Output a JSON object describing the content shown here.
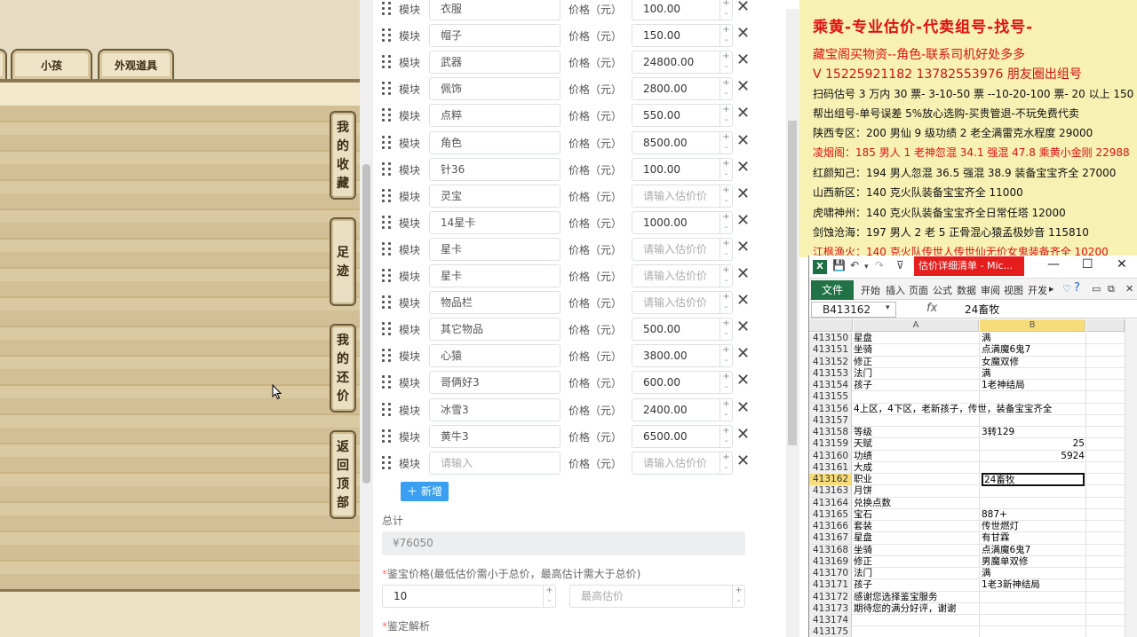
{
  "game": {
    "tabs": [
      "小孩",
      "外观道具"
    ],
    "side_buttons": [
      {
        "id": "collection",
        "chars": [
          "我",
          "的",
          "收",
          "藏"
        ]
      },
      {
        "id": "footprint",
        "chars": [
          "足",
          "迹"
        ]
      },
      {
        "id": "bargain",
        "chars": [
          "我",
          "的",
          "还",
          "价"
        ]
      },
      {
        "id": "top",
        "chars": [
          "返",
          "回",
          "顶",
          "部"
        ]
      }
    ]
  },
  "form": {
    "module_label": "模块",
    "price_label": "价格（元）",
    "name_placeholder": "请输入",
    "price_placeholder": "请输入估价价",
    "rows": [
      {
        "name": "衣服",
        "price": "100.00"
      },
      {
        "name": "帽子",
        "price": "150.00"
      },
      {
        "name": "武器",
        "price": "24800.00"
      },
      {
        "name": "佩饰",
        "price": "2800.00"
      },
      {
        "name": "点粹",
        "price": "550.00"
      },
      {
        "name": "角色",
        "price": "8500.00"
      },
      {
        "name": "针36",
        "price": "100.00"
      },
      {
        "name": "灵宝",
        "price": ""
      },
      {
        "name": "14星卡",
        "price": "1000.00"
      },
      {
        "name": "星卡",
        "price": ""
      },
      {
        "name": "星卡",
        "price": ""
      },
      {
        "name": "物品栏",
        "price": ""
      },
      {
        "name": "其它物品",
        "price": "500.00"
      },
      {
        "name": "心猿",
        "price": "3800.00"
      },
      {
        "name": "哥俩好3",
        "price": "600.00"
      },
      {
        "name": "冰雪3",
        "price": "2400.00"
      },
      {
        "name": "黄牛3",
        "price": "6500.00"
      },
      {
        "name": "",
        "price": ""
      }
    ],
    "add_button": "新增",
    "total_label": "总计",
    "total_value": "¥76050",
    "appraisal_label": "鉴宝价格(最低估价需小于总价，最高估计需大于总价)",
    "min_value": "10",
    "max_placeholder": "最高估价",
    "analysis_label": "鉴定解析",
    "required_mark": "*"
  },
  "doc": {
    "lines": [
      {
        "text": "乘黄-专业估价-代卖组号-找号-",
        "style": "big"
      },
      {
        "text": "藏宝阁买物资--角色-联系司机好处多多",
        "style": "mid"
      },
      {
        "text": "V 15225921182       13782553976 朋友圈出组号",
        "style": "mid2"
      },
      {
        "text": "扫码估号 3 万内 30 票- 3-10-50 票  --10-20-100 票- 20 以上 150",
        "style": "normal"
      },
      {
        "text": "帮出组号-单号误差 5%放心选购-买贵管退-不玩免费代卖",
        "style": "normal"
      },
      {
        "text": "陕西专区：200 男仙 9 级功绩 2 老全满雷克水程度 29000",
        "style": "normal"
      },
      {
        "text": "凌烟阁：185 男人 1 老神忽混 34.1 强混 47.8 乘黄小金刚 22988",
        "style": "red"
      },
      {
        "text": "红颜知己：194 男人忽混 36.5 强混 38.9 装备宝宝齐全 27000",
        "style": "normal"
      },
      {
        "text": "山西新区：140 克火队装备宝宝齐全 11000",
        "style": "normal"
      },
      {
        "text": "虎啸神州：140 克火队装备宝宝齐全日常任塔 12000",
        "style": "normal"
      },
      {
        "text": "剑蚀沧海：197 男人 2 老 5 正骨混心猿孟极妙音 115810",
        "style": "normal"
      },
      {
        "text": "江枫渔火：140 克火队传世人传世仙无价女鬼装备齐全 10200",
        "style": "red"
      }
    ]
  },
  "excel": {
    "title": "估价详细清单 - Mic...",
    "file_tab": "文件",
    "ribbon_tabs": [
      "开始",
      "插入",
      "页面",
      "公式",
      "数据",
      "审阅",
      "视图",
      "开发"
    ],
    "name_box": "B413162",
    "fx": "fx",
    "formula_value": "24畜牧",
    "col_a": "A",
    "col_b": "B",
    "rows": [
      {
        "n": "413150",
        "a": "星盘",
        "b": "满",
        "num": false
      },
      {
        "n": "413151",
        "a": "坐骑",
        "b": "点满魔6鬼7",
        "num": false
      },
      {
        "n": "413152",
        "a": "修正",
        "b": "女魔双修",
        "num": false
      },
      {
        "n": "413153",
        "a": "法门",
        "b": "满",
        "num": false
      },
      {
        "n": "413154",
        "a": "孩子",
        "b": "1老神结局",
        "num": false
      },
      {
        "n": "413155",
        "a": "",
        "b": "",
        "num": false
      },
      {
        "n": "413156",
        "a": "4上区，4下区，老新孩子，传世，装备宝宝齐全",
        "b": "",
        "num": false
      },
      {
        "n": "413157",
        "a": "",
        "b": "",
        "num": false
      },
      {
        "n": "413158",
        "a": "等级",
        "b": "3转129",
        "num": false
      },
      {
        "n": "413159",
        "a": "天赋",
        "b": "25",
        "num": true
      },
      {
        "n": "413160",
        "a": "功绩",
        "b": "5924",
        "num": true
      },
      {
        "n": "413161",
        "a": "大成",
        "b": "",
        "num": false
      },
      {
        "n": "413162",
        "a": "职业",
        "b": "24畜牧",
        "num": false,
        "selected": true
      },
      {
        "n": "413163",
        "a": "月饼",
        "b": "",
        "num": false
      },
      {
        "n": "413164",
        "a": "兑换点数",
        "b": "",
        "num": false
      },
      {
        "n": "413165",
        "a": "宝石",
        "b": "887+",
        "num": false
      },
      {
        "n": "413166",
        "a": "套装",
        "b": "传世燃灯",
        "num": false
      },
      {
        "n": "413167",
        "a": "星盘",
        "b": "有甘霖",
        "num": false
      },
      {
        "n": "413168",
        "a": "坐骑",
        "b": "点满魔6鬼7",
        "num": false
      },
      {
        "n": "413169",
        "a": "修正",
        "b": "男魔单双修",
        "num": false
      },
      {
        "n": "413170",
        "a": "法门",
        "b": "满",
        "num": false
      },
      {
        "n": "413171",
        "a": "孩子",
        "b": "1老3新神结局",
        "num": false
      },
      {
        "n": "413172",
        "a": "感谢您选择鉴宝服务",
        "b": "",
        "num": false
      },
      {
        "n": "413173",
        "a": "期待您的满分好评，谢谢",
        "b": "",
        "num": false
      },
      {
        "n": "413174",
        "a": "",
        "b": "",
        "num": false
      },
      {
        "n": "413175",
        "a": "",
        "b": "",
        "num": false
      }
    ]
  }
}
